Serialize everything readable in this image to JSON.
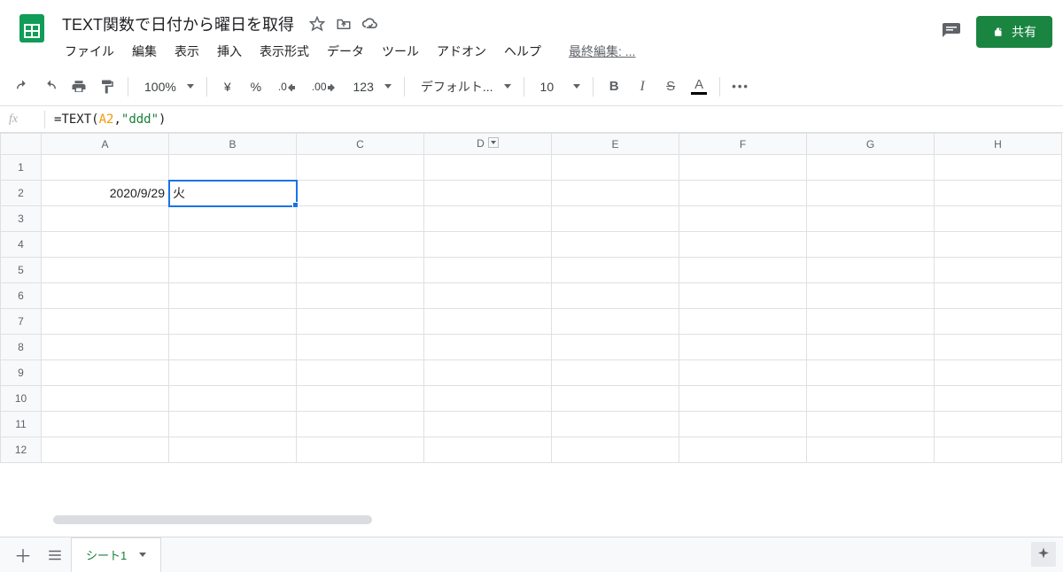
{
  "header": {
    "title": "TEXT関数で日付から曜日を取得",
    "last_edit": "最終編集: ...",
    "share_label": "共有"
  },
  "menu": {
    "file": "ファイル",
    "edit": "編集",
    "view": "表示",
    "insert": "挿入",
    "format": "表示形式",
    "data": "データ",
    "tools": "ツール",
    "addons": "アドオン",
    "help": "ヘルプ"
  },
  "toolbar": {
    "zoom": "100%",
    "currency": "¥",
    "percent": "%",
    "dec_dec": ".0",
    "inc_dec": ".00",
    "num_format": "123",
    "font": "デフォルト...",
    "font_size": "10",
    "bold": "B",
    "italic": "I",
    "strike": "S",
    "text_color": "A",
    "more": "•••"
  },
  "formula": {
    "fx": "fx",
    "eq": "=",
    "func": "TEXT",
    "open": "(",
    "ref": "A2",
    "comma": ",",
    "str": "\"ddd\"",
    "close": ")"
  },
  "columns": [
    "A",
    "B",
    "C",
    "D",
    "E",
    "F",
    "G",
    "H"
  ],
  "rows": [
    "1",
    "2",
    "3",
    "4",
    "5",
    "6",
    "7",
    "8",
    "9",
    "10",
    "11",
    "12"
  ],
  "cells": {
    "A2": "2020/9/29",
    "B2": "火"
  },
  "selected": "B2",
  "filter_col": "D",
  "sheet": {
    "tab1": "シート1"
  }
}
